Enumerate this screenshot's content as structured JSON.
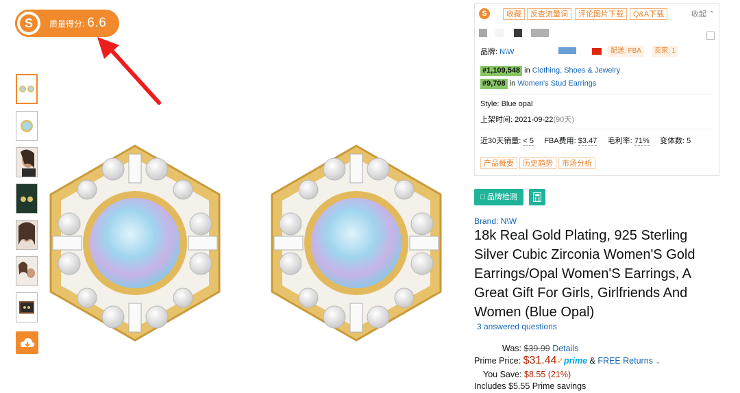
{
  "score": {
    "label": "质量得分:",
    "value": "6.6",
    "logo_letter": "S"
  },
  "thumbnails": [
    {
      "name": "thumb-earrings-pair",
      "active": true
    },
    {
      "name": "thumb-earring-closeup",
      "active": false
    },
    {
      "name": "thumb-model-side",
      "active": false
    },
    {
      "name": "thumb-earrings-dark",
      "active": false
    },
    {
      "name": "thumb-model-face",
      "active": false
    },
    {
      "name": "thumb-model-group",
      "active": false
    },
    {
      "name": "thumb-gift-box",
      "active": false
    }
  ],
  "panel": {
    "logo_letter": "S",
    "buttons": [
      "收藏",
      "反查流量词",
      "评论图片下载",
      "Q&A下载"
    ],
    "collapse_label": "收起",
    "colors": [
      "#a8a8a8",
      "#f4f4f4",
      "#3a3a3a",
      "#b0b0b0"
    ],
    "brand_label": "品牌:",
    "brand_value": "N\\W",
    "ship_tag": "配送: FBA",
    "seller_tag": "卖家: 1",
    "rank1_badge": "#1,109,548",
    "rank1_in": "in",
    "rank1_category": "Clothing, Shoes & Jewelry",
    "rank2_badge": "#9,708",
    "rank2_in": "in",
    "rank2_category": "Women's Stud Earrings",
    "style": "Style: Blue opal",
    "listed_label": "上架时间:",
    "listed_date": "2021-09-22",
    "listed_days": "(90天)",
    "sales_label": "近30天销量:",
    "sales_value": "< 5",
    "fba_label": "FBA费用:",
    "fba_value": "$3.47",
    "margin_label": "毛利率:",
    "margin_value": "71%",
    "variants_label": "变体数:",
    "variants_value": "5",
    "tabs": [
      "产品概要",
      "历史趋势",
      "市场分析"
    ]
  },
  "brand_check_label": "品牌检测",
  "product": {
    "brand": "Brand: N\\W",
    "title": "18k Real Gold Plating, 925 Sterling Silver Cubic Zirconia Women'S Gold Earrings/Opal Women'S Earrings, A Great Gift For Girls, Girlfriends And Women (Blue Opal)",
    "answered": "3 answered questions",
    "was_label": "Was:",
    "was_price": "$39.99",
    "details": "Details",
    "prime_label": "Prime Price:",
    "prime_price": "$31.44",
    "prime_logo": "prime",
    "free_returns": "FREE Returns",
    "amp": "&",
    "save_label": "You Save:",
    "save_value": "$8.55 (21%)",
    "includes": "Includes $5.55 Prime savings"
  }
}
